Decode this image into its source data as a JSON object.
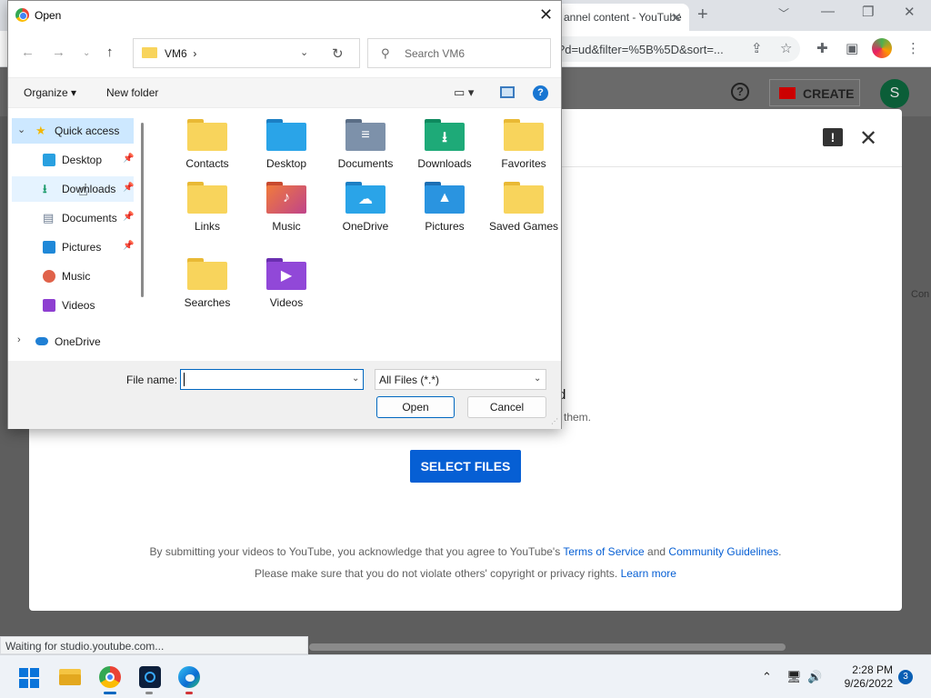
{
  "browser": {
    "tab_title": "annel content - YouTube",
    "url": "?d=ud&filter=%5B%5D&sort=...",
    "status": "Waiting for studio.youtube.com..."
  },
  "youtube": {
    "create_label": "CREATE",
    "avatar_letter": "S",
    "side_peek": "Con",
    "drag_title": "d",
    "drag_sub": "them.",
    "select_files": "SELECT FILES",
    "terms_prefix": "By submitting your videos to YouTube, you acknowledge that you agree to YouTube's",
    "terms_link1": "Terms of Service",
    "terms_and": "and",
    "terms_link2": "Community Guidelines",
    "terms_end": ".",
    "rights_text": "Please make sure that you do not violate others' copyright or privacy rights.",
    "learn_more": "Learn more"
  },
  "dialog": {
    "title": "Open",
    "path": "VM6",
    "search_placeholder": "Search VM6",
    "organize": "Organize",
    "new_folder": "New folder",
    "nav": [
      {
        "label": "Quick access"
      },
      {
        "label": "Desktop"
      },
      {
        "label": "Downloads"
      },
      {
        "label": "Documents"
      },
      {
        "label": "Pictures"
      },
      {
        "label": "Music"
      },
      {
        "label": "Videos"
      },
      {
        "label": "OneDrive"
      }
    ],
    "items": [
      {
        "label": "Contacts",
        "icon": "contacts-folder"
      },
      {
        "label": "Desktop",
        "icon": "desktop-folder"
      },
      {
        "label": "Documents",
        "icon": "documents-folder"
      },
      {
        "label": "Downloads",
        "icon": "downloads-folder"
      },
      {
        "label": "Favorites",
        "icon": "favorites-folder"
      },
      {
        "label": "Links",
        "icon": "links-folder"
      },
      {
        "label": "Music",
        "icon": "music-folder"
      },
      {
        "label": "OneDrive",
        "icon": "onedrive-folder"
      },
      {
        "label": "Pictures",
        "icon": "pictures-folder"
      },
      {
        "label": "Saved Games",
        "icon": "saved-games-folder"
      },
      {
        "label": "Searches",
        "icon": "searches-folder"
      },
      {
        "label": "Videos",
        "icon": "videos-folder"
      }
    ],
    "file_name_label": "File name:",
    "file_name_value": "",
    "filter": "All Files (*.*)",
    "open_button": "Open",
    "cancel_button": "Cancel"
  },
  "taskbar": {
    "time": "2:28 PM",
    "date": "9/26/2022",
    "notifications": "3"
  }
}
